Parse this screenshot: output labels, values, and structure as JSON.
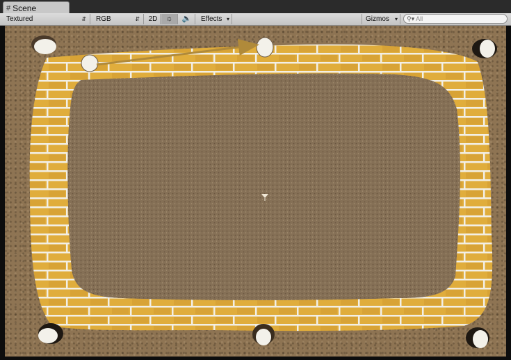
{
  "tab": {
    "title": "Scene"
  },
  "toolbar": {
    "render_mode": "Textured",
    "color_channel": "RGB",
    "mode_2d": "2D",
    "effects": "Effects",
    "gizmos": "Gizmos",
    "search_placeholder": "All",
    "lighting_icon": "sun-icon",
    "audio_icon": "speaker-icon"
  },
  "scene": {
    "ground_color": "#8e7453",
    "brick_color": "#e0ad3c",
    "mortar_color": "#f2efe6",
    "arrow_color": "#b08a3a"
  }
}
